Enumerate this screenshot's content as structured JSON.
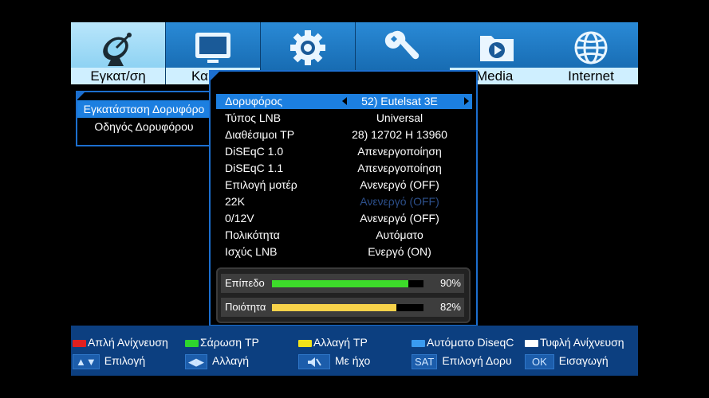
{
  "tabs": [
    {
      "label": "Εγκατ/ση",
      "icon": "satellite-dish-icon",
      "active": true
    },
    {
      "label": "Κα",
      "icon": "tv-icon",
      "active": false
    },
    {
      "label": "",
      "icon": "gear-icon",
      "active": false
    },
    {
      "label": "",
      "icon": "wrench-icon",
      "active": false
    },
    {
      "label": "Media",
      "icon": "media-folder-icon",
      "active": false
    },
    {
      "label": "Internet",
      "icon": "globe-icon",
      "active": false
    }
  ],
  "submenu": {
    "items": [
      "Εγκατάσταση Δορυφόρο",
      "Οδηγός Δορυφόρου"
    ],
    "selected": 0
  },
  "settings": [
    {
      "key": "Δορυφόρος",
      "value": "52) Eutelsat 3E",
      "selected": true,
      "dim": false
    },
    {
      "key": "Τύπος LNB",
      "value": "Universal",
      "selected": false,
      "dim": false
    },
    {
      "key": "Διαθέσιμοι TP",
      "value": "28) 12702 H 13960",
      "selected": false,
      "dim": false
    },
    {
      "key": "DiSEqC 1.0",
      "value": "Απενεργοποίηση",
      "selected": false,
      "dim": false
    },
    {
      "key": "DiSEqC 1.1",
      "value": "Απενεργοποίηση",
      "selected": false,
      "dim": false
    },
    {
      "key": "Επιλογή μοτέρ",
      "value": "Ανενεργό (OFF)",
      "selected": false,
      "dim": false
    },
    {
      "key": "22K",
      "value": "Ανενεργό (OFF)",
      "selected": false,
      "dim": true
    },
    {
      "key": "0/12V",
      "value": "Ανενεργό (OFF)",
      "selected": false,
      "dim": false
    },
    {
      "key": "Πολικότητα",
      "value": "Αυτόματο",
      "selected": false,
      "dim": false
    },
    {
      "key": "Ισχύς LNB",
      "value": "Ενεργό (ON)",
      "selected": false,
      "dim": false
    }
  ],
  "signal": {
    "level": {
      "label": "Επίπεδο",
      "percent": 90,
      "text": "90%",
      "color": "#3ddc2a"
    },
    "quality": {
      "label": "Ποιότητα",
      "percent": 82,
      "text": "82%",
      "color": "#f7d24a"
    }
  },
  "legend": {
    "row1": [
      {
        "color": "#e02020",
        "label": "Απλή Ανίχνευση"
      },
      {
        "color": "#2ed62e",
        "label": "Σάρωση TP"
      },
      {
        "color": "#f2e21a",
        "label": "Αλλαγή TP"
      },
      {
        "color": "#3a9bf0",
        "label": "Αυτόματο DiseqC"
      },
      {
        "color": "#ffffff",
        "label": "Τυφλή Ανίχνευση"
      }
    ],
    "row2": [
      {
        "key": "▲▼",
        "label": "Επιλογή"
      },
      {
        "key": "◀▶",
        "label": "Αλλαγή"
      },
      {
        "key": "mute",
        "label": "Με ήχο"
      },
      {
        "key": "SAT",
        "label": "Επιλογή Δορυ"
      },
      {
        "key": "OK",
        "label": "Εισαγωγή"
      }
    ]
  }
}
